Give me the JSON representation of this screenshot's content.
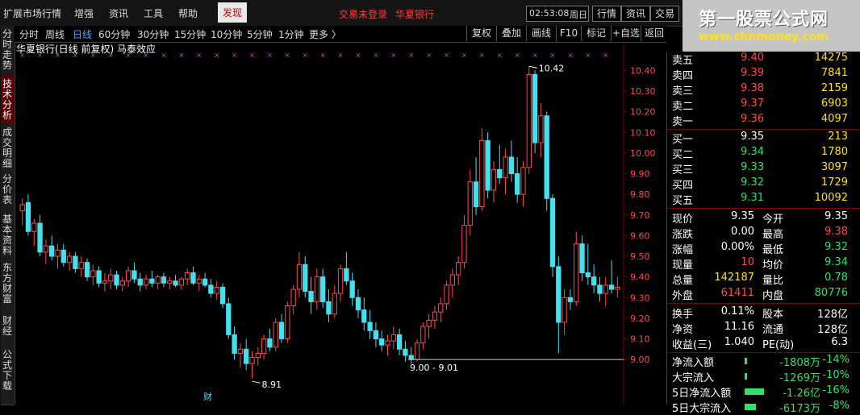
{
  "menu": {
    "items": [
      "扩展市场行情",
      "增强",
      "资讯",
      "工具",
      "帮助"
    ],
    "active": "发现",
    "alert_login": "交易未登录",
    "alert_stock": "华夏银行",
    "time": "02:53:08",
    "weekday": "周日",
    "buttons": [
      "行情",
      "资讯",
      "交易"
    ]
  },
  "logo": {
    "title": "第一股票公式网",
    "url": "www.chnmoney.com"
  },
  "side_tabs": [
    "分时走势",
    "技术分析",
    "成交明细",
    "分价表",
    "基本资料",
    "东方财富",
    "财经",
    "公式下载"
  ],
  "period_bar": {
    "periods": [
      "分时",
      "周线",
      "日线",
      "60分钟",
      "30分钟",
      "15分钟",
      "10分钟",
      "5分钟",
      "1分钟",
      "更多 〉"
    ],
    "active_index": 2,
    "tools": [
      "复权",
      "叠加",
      "画线",
      "F10",
      "标记",
      "+自选",
      "返回"
    ]
  },
  "chart_title": "华夏银行(日线 前复权) 马泰效应",
  "price_axis": [
    "10.40",
    "10.30",
    "10.20",
    "10.10",
    "10.00",
    "9.90",
    "9.80",
    "9.70",
    "9.60",
    "9.50",
    "9.40",
    "9.30",
    "9.20",
    "9.10",
    "9.00"
  ],
  "annotations": {
    "high_label": "10.42",
    "low_label": "8.91",
    "range_label": "9.00 - 9.01",
    "finance_marker": "财"
  },
  "colors": {
    "up": "#ff4a4a",
    "down": "#45e0f0",
    "flat_magenta": "#e040e0",
    "bg": "#000000",
    "grid_red": "#7a0000"
  },
  "quote": {
    "orderbook": [
      {
        "label": "卖五",
        "price": "9.40",
        "volume": "14275",
        "dir": "up"
      },
      {
        "label": "卖四",
        "price": "9.39",
        "volume": "7841",
        "dir": "up"
      },
      {
        "label": "卖三",
        "price": "9.38",
        "volume": "2159",
        "dir": "up"
      },
      {
        "label": "卖二",
        "price": "9.37",
        "volume": "6903",
        "dir": "up"
      },
      {
        "label": "卖一",
        "price": "9.36",
        "volume": "4097",
        "dir": "up"
      },
      {
        "label": "买一",
        "price": "9.35",
        "volume": "213",
        "dir": "flat"
      },
      {
        "label": "买二",
        "price": "9.34",
        "volume": "1780",
        "dir": "down"
      },
      {
        "label": "买三",
        "price": "9.33",
        "volume": "3097",
        "dir": "down"
      },
      {
        "label": "买四",
        "price": "9.32",
        "volume": "1729",
        "dir": "down"
      },
      {
        "label": "买五",
        "price": "9.31",
        "volume": "10092",
        "dir": "down"
      }
    ],
    "stats": [
      {
        "l1": "现价",
        "v1": "9.35",
        "c1": "white",
        "l2": "今开",
        "v2": "9.35",
        "c2": "white"
      },
      {
        "l1": "涨跌",
        "v1": "0.00",
        "c1": "white",
        "l2": "最高",
        "v2": "9.38",
        "c2": "up"
      },
      {
        "l1": "涨幅",
        "v1": "0.00%",
        "c1": "white",
        "l2": "最低",
        "v2": "9.32",
        "c2": "down"
      },
      {
        "l1": "现量",
        "v1": "10",
        "c1": "up",
        "l2": "均价",
        "v2": "9.34",
        "c2": "down"
      },
      {
        "l1": "总量",
        "v1": "142187",
        "c1": "yellow",
        "l2": "量比",
        "v2": "0.78",
        "c2": "down"
      },
      {
        "l1": "外盘",
        "v1": "61411",
        "c1": "up",
        "l2": "内盘",
        "v2": "80776",
        "c2": "down"
      }
    ],
    "stats2": [
      {
        "l1": "换手",
        "v1": "0.11%",
        "c1": "white",
        "l2": "股本",
        "v2": "128亿",
        "c2": "white"
      },
      {
        "l1": "净资",
        "v1": "11.16",
        "c1": "white",
        "l2": "流通",
        "v2": "128亿",
        "c2": "white"
      },
      {
        "l1": "收益(三)",
        "v1": "1.040",
        "c1": "white",
        "l2": "PE(动)",
        "v2": "6.3",
        "c2": "white"
      }
    ],
    "flows": [
      {
        "label": "净流入额",
        "value": "-1808万",
        "pct": "-14%",
        "bar": 0.05
      },
      {
        "label": "大宗流入",
        "value": "-1269万",
        "pct": "-10%",
        "bar": 0.05
      },
      {
        "label": "5日净流入额",
        "value": "-1.26亿",
        "pct": "-16%",
        "bar": 0.9
      },
      {
        "label": "5日大宗流入",
        "value": "-6173万",
        "pct": "-8%",
        "bar": 0.5
      }
    ]
  },
  "chart_data": {
    "type": "candlestick",
    "ylim": [
      8.86,
      10.46
    ],
    "candles": [
      [
        9.72,
        9.78,
        9.65,
        9.75
      ],
      [
        9.76,
        9.8,
        9.6,
        9.62
      ],
      [
        9.62,
        9.68,
        9.55,
        9.66
      ],
      [
        9.66,
        9.7,
        9.5,
        9.52
      ],
      [
        9.52,
        9.58,
        9.46,
        9.55
      ],
      [
        9.55,
        9.6,
        9.48,
        9.5
      ],
      [
        9.5,
        9.56,
        9.44,
        9.53
      ],
      [
        9.53,
        9.56,
        9.45,
        9.47
      ],
      [
        9.47,
        9.52,
        9.43,
        9.5
      ],
      [
        9.5,
        9.52,
        9.42,
        9.44
      ],
      [
        9.44,
        9.5,
        9.4,
        9.47
      ],
      [
        9.47,
        9.49,
        9.38,
        9.4
      ],
      [
        9.4,
        9.46,
        9.36,
        9.43
      ],
      [
        9.43,
        9.45,
        9.35,
        9.37
      ],
      [
        9.37,
        9.42,
        9.33,
        9.38
      ],
      [
        9.38,
        9.44,
        9.34,
        9.41
      ],
      [
        9.41,
        9.43,
        9.34,
        9.36
      ],
      [
        9.36,
        9.4,
        9.33,
        9.38
      ],
      [
        9.38,
        9.45,
        9.35,
        9.43
      ],
      [
        9.43,
        9.47,
        9.37,
        9.39
      ],
      [
        9.39,
        9.42,
        9.33,
        9.36
      ],
      [
        9.36,
        9.41,
        9.34,
        9.39
      ],
      [
        9.39,
        9.43,
        9.35,
        9.37
      ],
      [
        9.37,
        9.41,
        9.34,
        9.4
      ],
      [
        9.4,
        9.42,
        9.35,
        9.37
      ],
      [
        9.37,
        9.4,
        9.34,
        9.38
      ],
      [
        9.38,
        9.41,
        9.35,
        9.36
      ],
      [
        9.36,
        9.4,
        9.34,
        9.39
      ],
      [
        9.39,
        9.44,
        9.36,
        9.42
      ],
      [
        9.42,
        9.45,
        9.36,
        9.37
      ],
      [
        9.37,
        9.41,
        9.33,
        9.39
      ],
      [
        9.39,
        9.42,
        9.35,
        9.36
      ],
      [
        9.36,
        9.39,
        9.3,
        9.32
      ],
      [
        9.32,
        9.38,
        9.29,
        9.35
      ],
      [
        9.35,
        9.37,
        9.25,
        9.27
      ],
      [
        9.27,
        9.3,
        9.1,
        9.12
      ],
      [
        9.12,
        9.16,
        9.0,
        9.03
      ],
      [
        9.03,
        9.08,
        8.96,
        9.05
      ],
      [
        9.05,
        9.1,
        8.95,
        8.98
      ],
      [
        8.98,
        9.04,
        8.91,
        9.01
      ],
      [
        9.01,
        9.06,
        8.97,
        9.03
      ],
      [
        9.03,
        9.12,
        9.0,
        9.1
      ],
      [
        9.1,
        9.15,
        9.04,
        9.06
      ],
      [
        9.06,
        9.2,
        9.04,
        9.18
      ],
      [
        9.18,
        9.22,
        9.08,
        9.1
      ],
      [
        9.1,
        9.28,
        9.08,
        9.26
      ],
      [
        9.26,
        9.36,
        9.22,
        9.34
      ],
      [
        9.34,
        9.52,
        9.3,
        9.46
      ],
      [
        9.46,
        9.5,
        9.3,
        9.33
      ],
      [
        9.33,
        9.4,
        9.22,
        9.28
      ],
      [
        9.28,
        9.44,
        9.24,
        9.4
      ],
      [
        9.4,
        9.44,
        9.25,
        9.28
      ],
      [
        9.28,
        9.34,
        9.18,
        9.22
      ],
      [
        9.22,
        9.36,
        9.2,
        9.32
      ],
      [
        9.32,
        9.46,
        9.28,
        9.44
      ],
      [
        9.44,
        9.52,
        9.36,
        9.38
      ],
      [
        9.38,
        9.42,
        9.26,
        9.3
      ],
      [
        9.3,
        9.34,
        9.2,
        9.24
      ],
      [
        9.24,
        9.3,
        9.14,
        9.18
      ],
      [
        9.18,
        9.24,
        9.1,
        9.14
      ],
      [
        9.14,
        9.18,
        9.06,
        9.1
      ],
      [
        9.1,
        9.14,
        9.04,
        9.07
      ],
      [
        9.07,
        9.12,
        9.02,
        9.09
      ],
      [
        9.09,
        9.16,
        9.05,
        9.12
      ],
      [
        9.12,
        9.15,
        9.02,
        9.05
      ],
      [
        9.05,
        9.09,
        8.99,
        9.02
      ],
      [
        9.02,
        9.06,
        8.98,
        9.0
      ],
      [
        9.0,
        9.1,
        8.99,
        9.08
      ],
      [
        9.08,
        9.18,
        9.05,
        9.16
      ],
      [
        9.16,
        9.22,
        9.1,
        9.19
      ],
      [
        9.19,
        9.26,
        9.15,
        9.23
      ],
      [
        9.23,
        9.3,
        9.18,
        9.27
      ],
      [
        9.27,
        9.38,
        9.24,
        9.36
      ],
      [
        9.36,
        9.44,
        9.3,
        9.41
      ],
      [
        9.41,
        9.5,
        9.36,
        9.47
      ],
      [
        9.47,
        9.7,
        9.44,
        9.65
      ],
      [
        9.65,
        9.92,
        9.6,
        9.86
      ],
      [
        9.86,
        9.98,
        9.7,
        9.74
      ],
      [
        9.74,
        10.12,
        9.72,
        10.06
      ],
      [
        10.06,
        10.1,
        9.78,
        9.82
      ],
      [
        9.82,
        9.96,
        9.76,
        9.92
      ],
      [
        9.92,
        10.04,
        9.85,
        9.88
      ],
      [
        9.88,
        10.02,
        9.8,
        9.98
      ],
      [
        9.98,
        10.06,
        9.86,
        9.9
      ],
      [
        9.9,
        9.98,
        9.76,
        9.8
      ],
      [
        9.8,
        9.96,
        9.74,
        9.93
      ],
      [
        9.93,
        10.42,
        9.9,
        10.38
      ],
      [
        10.38,
        10.4,
        10.0,
        10.05
      ],
      [
        10.05,
        10.24,
        9.98,
        10.18
      ],
      [
        10.18,
        10.2,
        9.72,
        9.78
      ],
      [
        9.78,
        9.8,
        9.4,
        9.45
      ],
      [
        9.45,
        9.5,
        9.03,
        9.18
      ],
      [
        9.18,
        9.34,
        9.12,
        9.3
      ],
      [
        9.3,
        9.34,
        9.24,
        9.28
      ],
      [
        9.28,
        9.62,
        9.26,
        9.56
      ],
      [
        9.56,
        9.6,
        9.38,
        9.42
      ],
      [
        9.42,
        9.56,
        9.36,
        9.4
      ],
      [
        9.4,
        9.46,
        9.32,
        9.36
      ],
      [
        9.36,
        9.4,
        9.28,
        9.32
      ],
      [
        9.32,
        9.4,
        9.26,
        9.36
      ],
      [
        9.36,
        9.48,
        9.32,
        9.34
      ],
      [
        9.34,
        9.4,
        9.3,
        9.35
      ]
    ]
  }
}
